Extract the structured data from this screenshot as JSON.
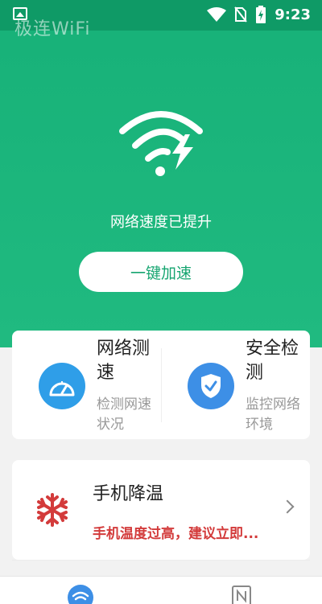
{
  "status_bar": {
    "time": "9:23",
    "icons": [
      "image-icon",
      "wifi-icon",
      "no-sim-icon",
      "battery-charging-icon"
    ]
  },
  "header": {
    "app_title": "极连WiFi"
  },
  "hero": {
    "icon": "wifi-bolt-icon",
    "status_text": "网络速度已提升",
    "button_label": "一键加速"
  },
  "tools": [
    {
      "title": "网络测速",
      "desc": "检测网速状况",
      "icon": "speedometer-icon",
      "color": "#2f9ee8"
    },
    {
      "title": "安全检测",
      "desc": "监控网络环境",
      "icon": "shield-check-icon",
      "color": "#3d8fe6"
    }
  ],
  "cooling": {
    "title": "手机降温",
    "desc": "手机温度过高，建议立即...",
    "icon": "snowflake-icon",
    "desc_color": "#d33b3b"
  },
  "bottom_nav": {
    "items": [
      {
        "icon": "wifi-tab-icon",
        "color": "#3d8fe6"
      },
      {
        "icon": "news-tab-icon",
        "color": "#888888"
      }
    ]
  },
  "colors": {
    "brand": "#1bb47b"
  }
}
